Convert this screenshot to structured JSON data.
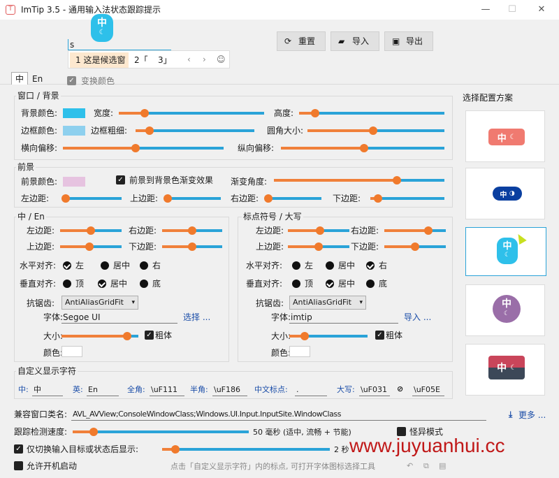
{
  "window": {
    "title": "ImTip 3.5 - 通用输入法状态跟踪提示",
    "minimize": "—",
    "maximize": "☐",
    "close": "✕"
  },
  "floating": {
    "icon_text": "中"
  },
  "candidate": {
    "input_text": "s",
    "item1": "1 这是候选窗",
    "item2": "2「",
    "item3": "3」",
    "prev": "‹",
    "next": "›",
    "emoji": "☺"
  },
  "toolbar": {
    "reset": "重置",
    "import": "导入",
    "export": "导出"
  },
  "tabs": {
    "zh": "中",
    "en": "En"
  },
  "swap_colors": "变换颜色",
  "window_bg": {
    "title": "窗口 / 背景",
    "bg_color": "背景颜色:",
    "width": "宽度:",
    "height": "高度:",
    "border_color": "边框颜色:",
    "border_width": "边框粗细:",
    "corner": "圆角大小:",
    "h_offset": "横向偏移:",
    "v_offset": "纵向偏移:",
    "colors": {
      "bg": "#2ec0ea",
      "border": "#8ed0ee"
    },
    "values": {
      "width": 0.18,
      "height": 0.11,
      "border_width": 0.12,
      "corner": 0.48,
      "h_offset": 0.45,
      "v_offset": 0.51
    }
  },
  "foreground": {
    "title": "前景",
    "fg_color": "前景颜色:",
    "gradient": "前景到背景色渐变效果",
    "angle": "渐变角度:",
    "left": "左边距:",
    "top": "上边距:",
    "right": "右边距:",
    "bottom": "下边距:",
    "color": "#e6c3e0",
    "values": {
      "angle": 0.72,
      "left": 0.0,
      "top": 0.0,
      "right": 0.0,
      "bottom": 0.1
    }
  },
  "zh_en": {
    "title": "中 / En",
    "left": "左边距:",
    "right": "右边距:",
    "top": "上边距:",
    "bottom": "下边距:",
    "halign": "水平对齐:",
    "valign": "垂直对齐:",
    "h_opts": [
      "左",
      "居中",
      "右"
    ],
    "v_opts": [
      "顶",
      "居中",
      "底"
    ],
    "aa": "抗锯齿:",
    "aa_value": "AntiAliasGridFit",
    "font": "字体:",
    "font_value": "Segoe UI",
    "choose": "选择 ...",
    "size": "大小:",
    "bold": "粗体",
    "color": "颜色:",
    "values": {
      "left": 0.5,
      "right": 0.5,
      "top": 0.48,
      "bottom": 0.5,
      "size": 0.85
    }
  },
  "punct": {
    "title": "标点符号 / 大写",
    "left": "左边距:",
    "right": "右边距:",
    "top": "上边距:",
    "bottom": "下边距:",
    "halign": "水平对齐:",
    "valign": "垂直对齐:",
    "h_opts": [
      "左",
      "居中",
      "右"
    ],
    "v_opts": [
      "顶",
      "居中",
      "底"
    ],
    "aa": "抗锯齿:",
    "aa_value": "AntiAliasGridFit",
    "font": "字体:",
    "font_value": "imtip",
    "import": "导入 ...",
    "size": "大小:",
    "bold": "粗体",
    "color": "颜色:",
    "values": {
      "left": 0.52,
      "right": 0.72,
      "top": 0.5,
      "bottom": 0.5,
      "size": 0.2
    }
  },
  "custom": {
    "title": "自定义显示字符",
    "zh_label": "中:",
    "zh": "中",
    "en_label": "英:",
    "en": "En",
    "full_label": "全角:",
    "full": "\\uF111",
    "half_label": "半角:",
    "half": "\\uF186",
    "cnp_label": "中文标点:",
    "cnp": ".",
    "caps_label": "大写:",
    "caps": "\\uF031",
    "disabled": "\\uF05E"
  },
  "schemes": {
    "title": "选择配置方案",
    "p1": "中",
    "p2": "中",
    "p3": "中",
    "p4": "中",
    "p5": "中"
  },
  "compat": {
    "label": "兼容窗口类名:",
    "value": "AVL_AVView;ConsoleWindowClass;Windows.UI.Input.InputSite.WindowClass",
    "more": "更多 ..."
  },
  "track": {
    "label": "跟踪检测速度:",
    "value": "50 毫秒 (适中, 流畅 + 节能)",
    "weird": "怪异模式",
    "level": 0.12
  },
  "switch_show": {
    "label": "仅切换输入目标或状态后显示:",
    "value": "2 秒",
    "level": 0.08
  },
  "autostart": "允许开机启动",
  "hint": "点击「自定义显示字符」内的标点, 可打开字体图标选择工具",
  "watermark": "www.juyuanhui.cc"
}
